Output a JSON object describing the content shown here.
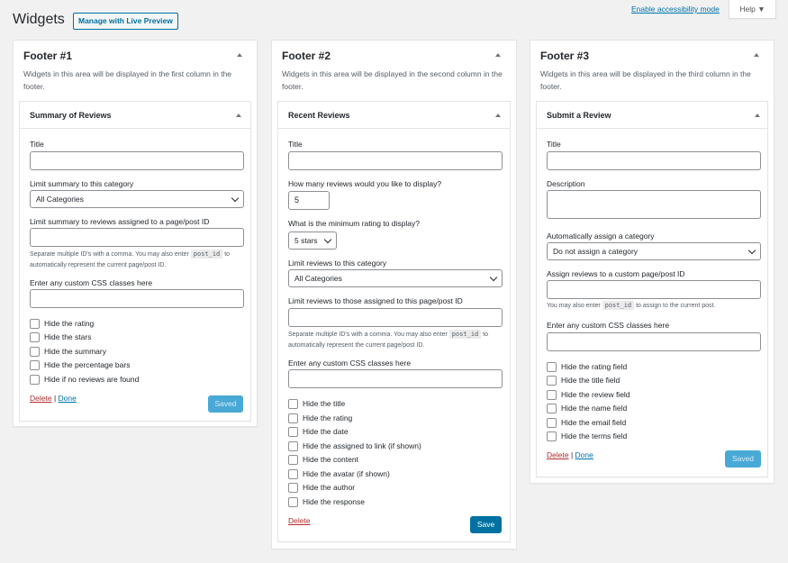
{
  "header": {
    "title": "Widgets",
    "live_preview_button": "Manage with Live Preview",
    "accessibility_link": "Enable accessibility mode",
    "help_tab": "Help ▼"
  },
  "areas": [
    {
      "title": "Footer #1",
      "description": "Widgets in this area will be displayed in the first column in the footer.",
      "widget": {
        "title": "Summary of Reviews",
        "title_label": "Title",
        "title_value": "",
        "category_label": "Limit summary to this category",
        "category_value": "All Categories",
        "postid_label": "Limit summary to reviews assigned to a page/post ID",
        "postid_value": "",
        "hint_before": "Separate multiple ID's with a comma. You may also enter",
        "hint_code": "post_id",
        "hint_after": "to automatically represent the current page/post ID.",
        "css_label": "Enter any custom CSS classes here",
        "css_value": "",
        "checkboxes": [
          "Hide the rating",
          "Hide the stars",
          "Hide the summary",
          "Hide the percentage bars",
          "Hide if no reviews are found"
        ],
        "delete": "Delete",
        "separator": "|",
        "done": "Done",
        "save": "Saved"
      }
    },
    {
      "title": "Footer #2",
      "description": "Widgets in this area will be displayed in the second column in the footer.",
      "widget": {
        "title": "Recent Reviews",
        "title_label": "Title",
        "title_value": "",
        "count_label": "How many reviews would you like to display?",
        "count_value": "5",
        "rating_label": "What is the minimum rating to display?",
        "rating_value": "5 stars",
        "category_label": "Limit reviews to this category",
        "category_value": "All Categories",
        "postid_label": "Limit reviews to those assigned to this page/post ID",
        "postid_value": "",
        "hint_before": "Separate multiple ID's with a comma. You may also enter",
        "hint_code": "post_id",
        "hint_after": "to automatically represent the current page/post ID.",
        "css_label": "Enter any custom CSS classes here",
        "css_value": "",
        "checkboxes": [
          "Hide the title",
          "Hide the rating",
          "Hide the date",
          "Hide the assigned to link (if shown)",
          "Hide the content",
          "Hide the avatar (if shown)",
          "Hide the author",
          "Hide the response"
        ],
        "delete": "Delete",
        "save": "Save"
      }
    },
    {
      "title": "Footer #3",
      "description": "Widgets in this area will be displayed in the third column in the footer.",
      "widget": {
        "title": "Submit a Review",
        "title_label": "Title",
        "title_value": "",
        "description_label": "Description",
        "description_value": "",
        "category_label": "Automatically assign a category",
        "category_value": "Do not assign a category",
        "postid_label": "Assign reviews to a custom page/post ID",
        "postid_value": "",
        "hint_before": "You may also enter",
        "hint_code": "post_id",
        "hint_after": "to assign to the current post.",
        "css_label": "Enter any custom CSS classes here",
        "css_value": "",
        "checkboxes": [
          "Hide the rating field",
          "Hide the title field",
          "Hide the review field",
          "Hide the name field",
          "Hide the email field",
          "Hide the terms field"
        ],
        "delete": "Delete",
        "separator": "|",
        "done": "Done",
        "save": "Saved"
      }
    }
  ]
}
